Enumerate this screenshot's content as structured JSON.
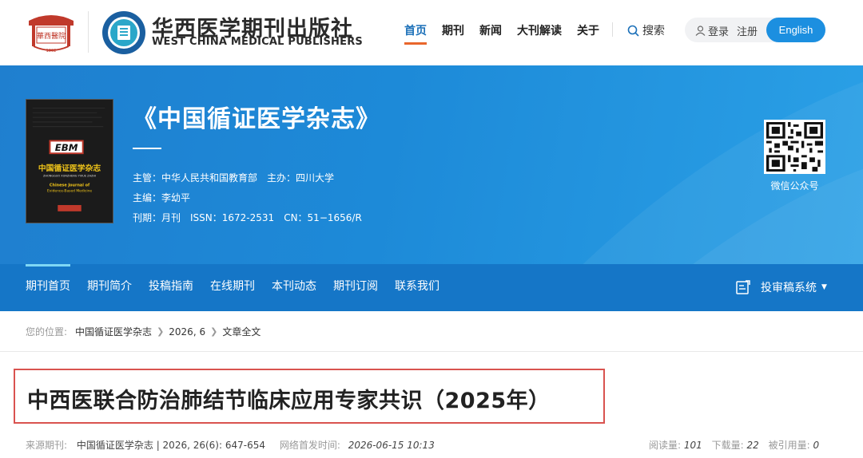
{
  "header": {
    "brand_cn": "华西医学期刊出版社",
    "brand_en": "WEST CHINA MEDICAL PUBLISHERS",
    "logo_left_text": "華西醫院",
    "logo_left_year": "1892",
    "nav": [
      {
        "label": "首页",
        "active": true
      },
      {
        "label": "期刊",
        "active": false
      },
      {
        "label": "新闻",
        "active": false
      },
      {
        "label": "大刊解读",
        "active": false
      },
      {
        "label": "关于",
        "active": false
      }
    ],
    "search_label": "搜索",
    "login_label": "登录",
    "register_label": "注册",
    "english_label": "English",
    "accent_color": "#1c8fe0",
    "nav_underline_color": "#e9662c"
  },
  "banner": {
    "journal_title": "《中国循证医学杂志》",
    "meta_line1": [
      "主管：中华人民共和国教育部",
      "主办：四川大学"
    ],
    "meta_line2": "主编：李幼平",
    "meta_line3": [
      "刊期：月刊",
      "ISSN：1672-2531",
      "CN：51−1656/R"
    ],
    "qr_label": "微信公众号",
    "cover": {
      "badge": "EBM",
      "title_cn": "中国循证医学杂志",
      "pinyin": "ZHONGGUO XUNZHENG YIXUE ZAZHI",
      "title_en_1": "Chinese Journal of",
      "title_en_2": "Evidence-Based Medicine"
    }
  },
  "subnav": {
    "items": [
      {
        "label": "期刊首页",
        "active": true
      },
      {
        "label": "期刊简介",
        "active": false
      },
      {
        "label": "投稿指南",
        "active": false
      },
      {
        "label": "在线期刊",
        "active": false
      },
      {
        "label": "本刊动态",
        "active": false
      },
      {
        "label": "期刊订阅",
        "active": false
      },
      {
        "label": "联系我们",
        "active": false
      }
    ],
    "review_system_label": "投审稿系统",
    "active_indicator_color": "#7fd7f5"
  },
  "breadcrumb": {
    "prefix": "您的位置:",
    "items": [
      "中国循证医学杂志",
      "2026, 6",
      "文章全文"
    ]
  },
  "article": {
    "title": "中西医联合防治肺结节临床应用专家共识（2025年）",
    "source_label": "来源期刊:",
    "source_value": "中国循证医学杂志 | 2026, 26(6): 647-654",
    "online_label": "网络首发时间:",
    "online_value": "2026-06-15 10:13",
    "stats": {
      "reads_label": "阅读量:",
      "reads": "101",
      "downloads_label": "下载量:",
      "downloads": "22",
      "citations_label": "被引用量:",
      "citations": "0"
    },
    "highlight_color": "#d9534f"
  }
}
